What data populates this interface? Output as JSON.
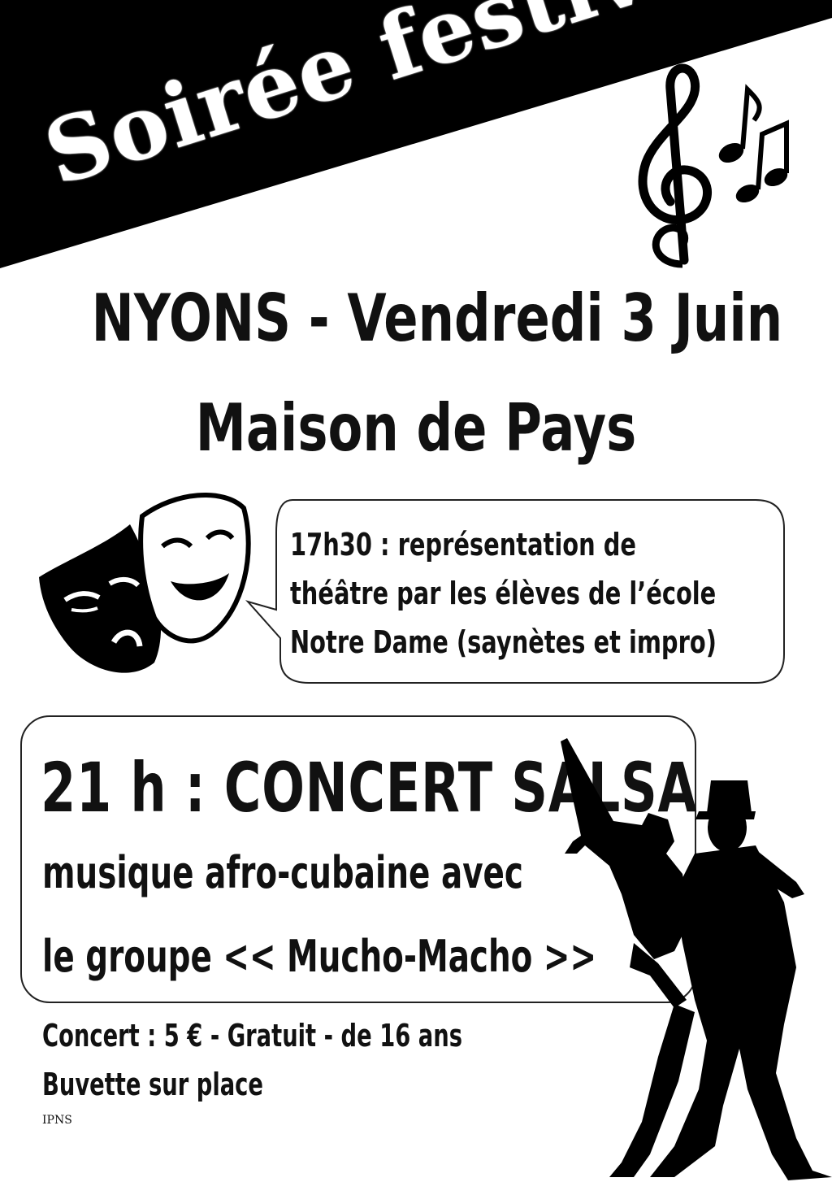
{
  "banner": {
    "title": "Soirée festive"
  },
  "event": {
    "city_date": "NYONS - Vendredi 3 Juin",
    "venue": "Maison de Pays"
  },
  "theatre": {
    "lines": [
      "17h30 : représentation de",
      "théâtre par les élèves de l’école",
      "Notre Dame (saynètes et impro)"
    ]
  },
  "concert": {
    "title": "21 h : CONCERT SALSA",
    "line1": "musique afro-cubaine avec",
    "line2": "le groupe << Mucho-Macho >>"
  },
  "footer": {
    "price": "Concert : 5 € - Gratuit - de 16 ans",
    "bar": "Buvette sur place",
    "ipns": "IPNS"
  },
  "icons": [
    "treble-clef-icon",
    "theatre-masks-icon",
    "salsa-dancers-silhouette"
  ],
  "colors": {
    "ink": "#111111",
    "paper": "#ffffff"
  }
}
